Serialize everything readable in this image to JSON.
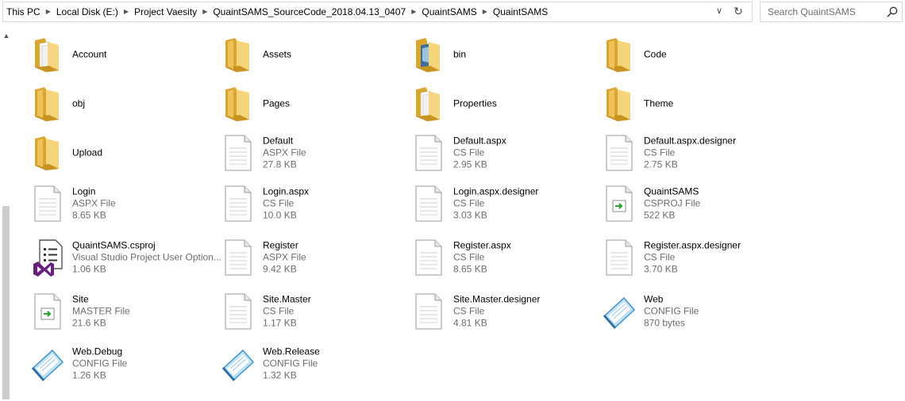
{
  "breadcrumb": [
    "This PC",
    "Local Disk (E:)",
    "Project Vaesity",
    "QuaintSAMS_SourceCode_2018.04.13_0407",
    "QuaintSAMS",
    "QuaintSAMS"
  ],
  "search": {
    "placeholder": "Search QuaintSAMS"
  },
  "items": [
    {
      "name": "Account",
      "icon": "folder-docs"
    },
    {
      "name": "Assets",
      "icon": "folder"
    },
    {
      "name": "bin",
      "icon": "folder-image"
    },
    {
      "name": "Code",
      "icon": "folder"
    },
    {
      "name": "obj",
      "icon": "folder"
    },
    {
      "name": "Pages",
      "icon": "folder"
    },
    {
      "name": "Properties",
      "icon": "folder-docs"
    },
    {
      "name": "Theme",
      "icon": "folder"
    },
    {
      "name": "Upload",
      "icon": "folder"
    },
    {
      "name": "Default",
      "type": "ASPX File",
      "size": "27.8 KB",
      "icon": "file"
    },
    {
      "name": "Default.aspx",
      "type": "CS File",
      "size": "2.95 KB",
      "icon": "file"
    },
    {
      "name": "Default.aspx.designer",
      "type": "CS File",
      "size": "2.75 KB",
      "icon": "file"
    },
    {
      "name": "Login",
      "type": "ASPX File",
      "size": "8.65 KB",
      "icon": "file"
    },
    {
      "name": "Login.aspx",
      "type": "CS File",
      "size": "10.0 KB",
      "icon": "file"
    },
    {
      "name": "Login.aspx.designer",
      "type": "CS File",
      "size": "3.03 KB",
      "icon": "file"
    },
    {
      "name": "QuaintSAMS",
      "type": "CSPROJ File",
      "size": "522 KB",
      "icon": "file-arrow"
    },
    {
      "name": "QuaintSAMS.csproj",
      "type": "Visual Studio Project User Option...",
      "size": "1.06 KB",
      "icon": "vs-project"
    },
    {
      "name": "Register",
      "type": "ASPX File",
      "size": "9.42 KB",
      "icon": "file"
    },
    {
      "name": "Register.aspx",
      "type": "CS File",
      "size": "8.65 KB",
      "icon": "file"
    },
    {
      "name": "Register.aspx.designer",
      "type": "CS File",
      "size": "3.70 KB",
      "icon": "file"
    },
    {
      "name": "Site",
      "type": "MASTER File",
      "size": "21.6 KB",
      "icon": "file-arrow"
    },
    {
      "name": "Site.Master",
      "type": "CS File",
      "size": "1.17 KB",
      "icon": "file"
    },
    {
      "name": "Site.Master.designer",
      "type": "CS File",
      "size": "4.81 KB",
      "icon": "file"
    },
    {
      "name": "Web",
      "type": "CONFIG File",
      "size": "870 bytes",
      "icon": "notepad"
    },
    {
      "name": "Web.Debug",
      "type": "CONFIG File",
      "size": "1.26 KB",
      "icon": "notepad"
    },
    {
      "name": "Web.Release",
      "type": "CONFIG File",
      "size": "1.32 KB",
      "icon": "notepad"
    }
  ]
}
